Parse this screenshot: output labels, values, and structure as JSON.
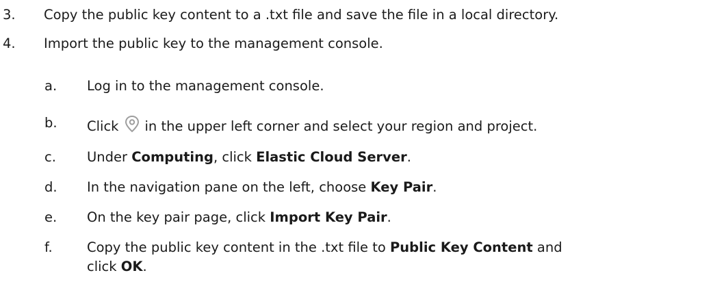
{
  "steps": [
    {
      "num": "3.",
      "text": "Copy the public key content to a .txt file and save the file in a local directory."
    },
    {
      "num": "4.",
      "text": "Import the public key to the management console."
    }
  ],
  "substeps": {
    "a": {
      "letter": "a.",
      "text": "Log in to the management console."
    },
    "b": {
      "letter": "b.",
      "pre": "Click",
      "post": "in the upper left corner and select your region and project.",
      "icon": "location-pin-icon"
    },
    "c": {
      "letter": "c.",
      "pre": "Under ",
      "bold1": "Computing",
      "mid": ", click ",
      "bold2": "Elastic Cloud Server",
      "post": "."
    },
    "d": {
      "letter": "d.",
      "pre": "In the navigation pane on the left, choose ",
      "bold1": "Key Pair",
      "post": "."
    },
    "e": {
      "letter": "e.",
      "pre": "On the key pair page, click ",
      "bold1": "Import Key Pair",
      "post": "."
    },
    "f": {
      "letter": "f.",
      "pre": "Copy the public key content in the .txt file to ",
      "bold1": "Public Key Content",
      "post": " and",
      "line2_pre": "click ",
      "line2_bold": "OK",
      "line2_post": "."
    }
  },
  "colors": {
    "text": "#1a1a1a",
    "icon": "#9e9e9e"
  }
}
